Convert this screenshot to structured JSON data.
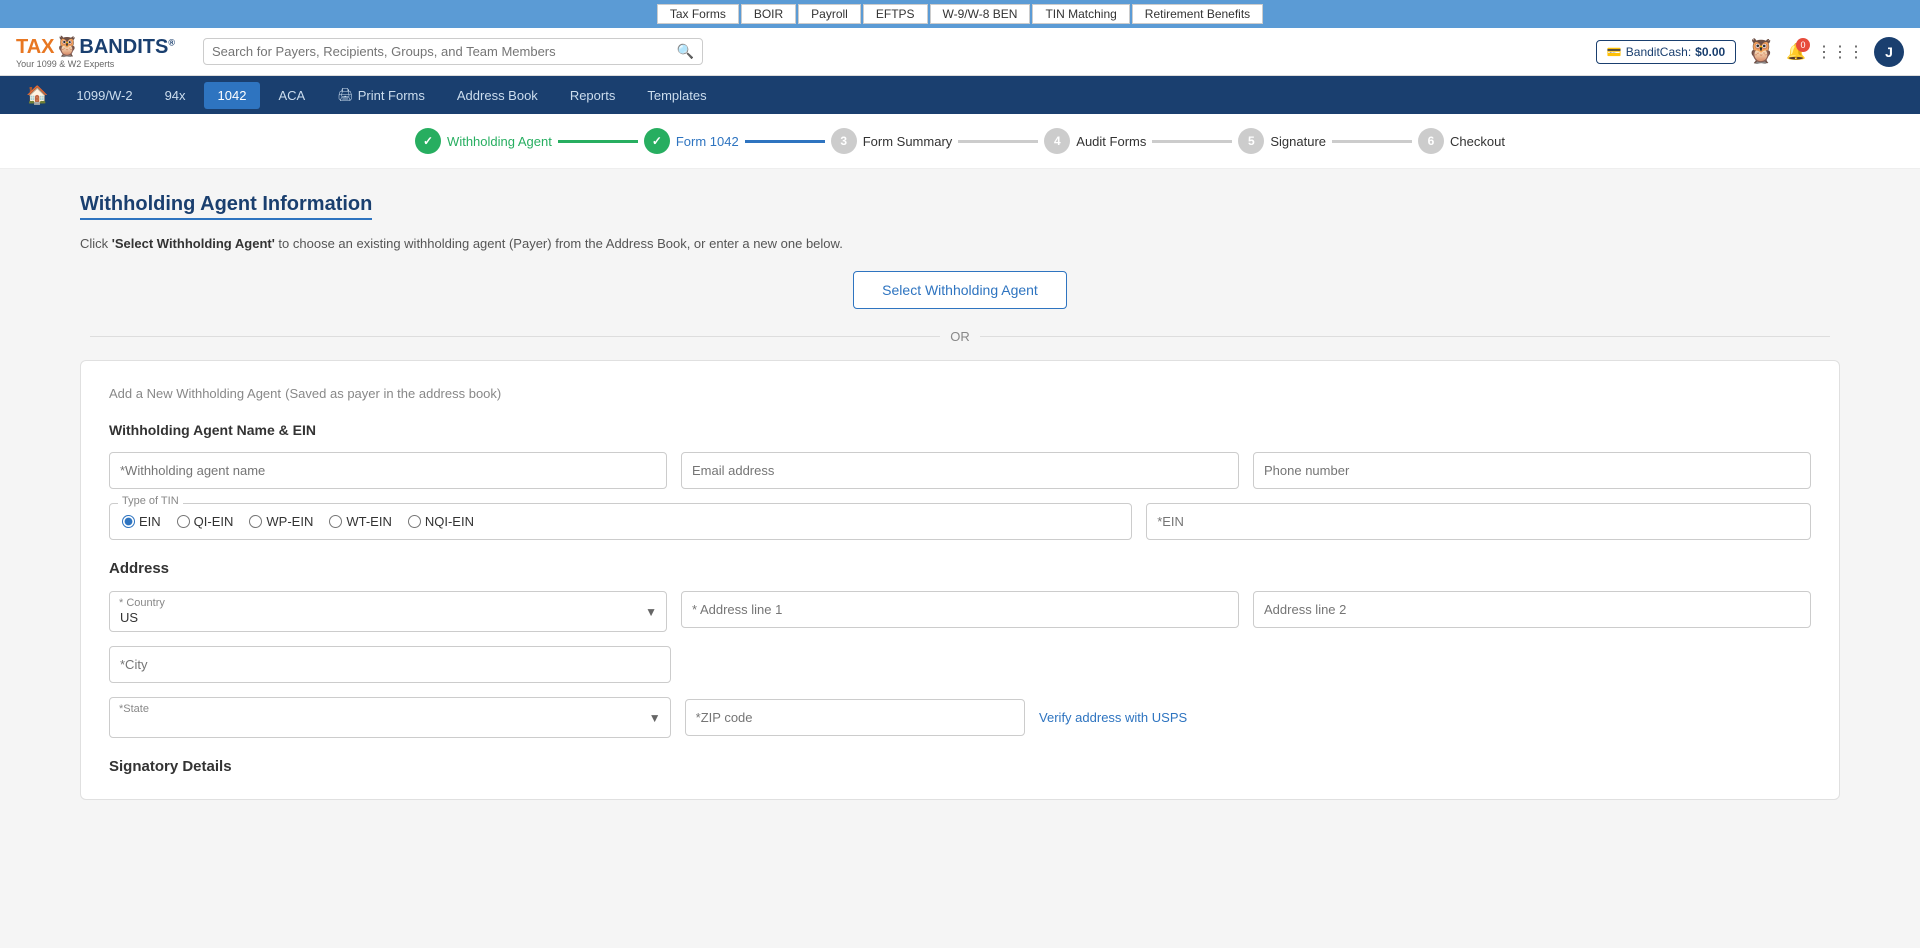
{
  "top_nav": {
    "items": [
      "Tax Forms",
      "BOIR",
      "Payroll",
      "EFTPS",
      "W-9/W-8 BEN",
      "TIN Matching",
      "Retirement Benefits"
    ]
  },
  "header": {
    "logo": "TAX BANDITS",
    "logo_sub": "Your 1099 & W2 Experts",
    "search_placeholder": "Search for Payers, Recipients, Groups, and Team Members",
    "bandit_cash_label": "BanditCash:",
    "bandit_cash_value": "$0.00",
    "notification_count": "0",
    "user_initial": "J"
  },
  "second_nav": {
    "items": [
      {
        "label": "1099/W-2",
        "active": false
      },
      {
        "label": "94x",
        "active": false
      },
      {
        "label": "1042",
        "active": true
      },
      {
        "label": "ACA",
        "active": false
      },
      {
        "label": "Print Forms",
        "active": false,
        "has_icon": true
      },
      {
        "label": "Address Book",
        "active": false
      },
      {
        "label": "Reports",
        "active": false
      },
      {
        "label": "Templates",
        "active": false
      }
    ]
  },
  "stepper": {
    "steps": [
      {
        "number": "✓",
        "label": "Withholding Agent",
        "state": "done"
      },
      {
        "number": "✓",
        "label": "Form 1042",
        "state": "active"
      },
      {
        "number": "3",
        "label": "Form Summary",
        "state": "pending"
      },
      {
        "number": "4",
        "label": "Audit Forms",
        "state": "pending"
      },
      {
        "number": "5",
        "label": "Signature",
        "state": "pending"
      },
      {
        "number": "6",
        "label": "Checkout",
        "state": "pending"
      }
    ]
  },
  "page": {
    "title": "Withholding Agent Information",
    "description_prefix": "Click ",
    "description_highlight": "'Select Withholding Agent'",
    "description_suffix": " to choose an existing withholding agent (Payer) from the Address Book, or enter a new one below.",
    "select_btn_label": "Select Withholding Agent",
    "or_label": "OR",
    "form_card": {
      "title": "Add a New Withholding Agent",
      "title_sub": "(Saved as payer in the address book)",
      "section_name_ein": "Withholding Agent Name & EIN",
      "fields": {
        "agent_name_placeholder": "*Withholding agent name",
        "email_placeholder": "Email address",
        "phone_placeholder": "Phone number",
        "tin_legend": "Type of TIN",
        "tin_options": [
          "EIN",
          "QI-EIN",
          "WP-EIN",
          "WT-EIN",
          "NQI-EIN"
        ],
        "tin_selected": "EIN",
        "ein_placeholder": "*EIN"
      },
      "address": {
        "section_title": "Address",
        "country_label": "* Country",
        "country_value": "US",
        "address1_placeholder": "* Address line 1",
        "address2_placeholder": "Address line 2",
        "city_placeholder": "*City",
        "state_label": "*State",
        "zip_placeholder": "*ZIP code",
        "verify_label": "Verify address with USPS"
      },
      "signatory": {
        "section_title": "Signatory Details"
      }
    }
  }
}
